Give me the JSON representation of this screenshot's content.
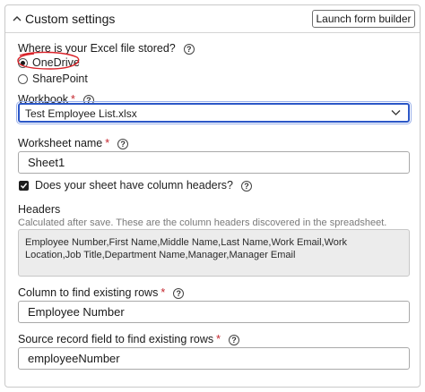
{
  "header": {
    "title": "Custom settings",
    "launch_button": "Launch form builder"
  },
  "storage": {
    "label": "Where is your Excel file stored?",
    "help": "?",
    "options": [
      {
        "label": "OneDrive",
        "selected": true
      },
      {
        "label": "SharePoint",
        "selected": false
      }
    ]
  },
  "workbook": {
    "label": "Workbook",
    "required_mark": "*",
    "help": "?",
    "value": "Test Employee List.xlsx"
  },
  "worksheet": {
    "label": "Worksheet name",
    "required_mark": "*",
    "help": "?",
    "value": "Sheet1"
  },
  "column_headers": {
    "label": "Does your sheet have column headers?",
    "help": "?",
    "checked": true
  },
  "headers": {
    "label": "Headers",
    "description": "Calculated after save. These are the column headers discovered in the spreadsheet.",
    "value": "Employee Number,First Name,Middle Name,Last Name,Work Email,Work Location,Job Title,Department Name,Manager,Manager Email"
  },
  "find_column": {
    "label": "Column to find existing rows",
    "required_mark": "*",
    "help": "?",
    "value": "Employee Number"
  },
  "source_field": {
    "label": "Source record field to find existing rows",
    "required_mark": "*",
    "help": "?",
    "value": "employeeNumber"
  },
  "colors": {
    "focus_border": "#2b57c7",
    "required": "#c4262e",
    "annotation": "#d9232a"
  }
}
